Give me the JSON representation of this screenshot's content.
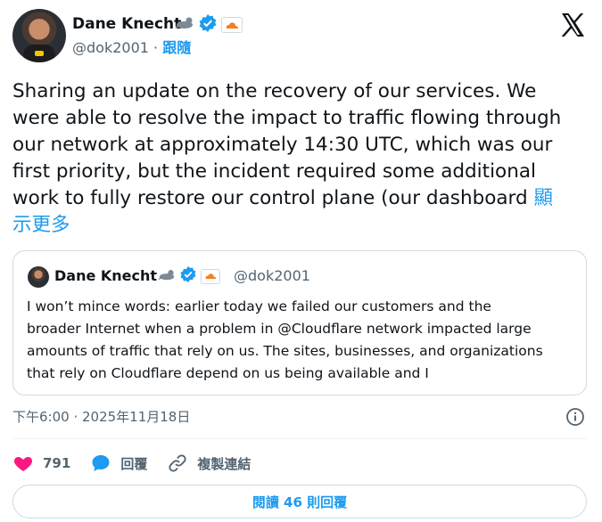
{
  "author": {
    "name": "Dane Knecht",
    "handle": "@dok2001",
    "separator": " · ",
    "follow_label": "跟隨"
  },
  "tweet": {
    "lines": [
      "Sharing an update on the recovery of our services. We",
      "were able to resolve the impact to traffic flowing through",
      "our network at approximately 14:30 UTC, which was our",
      "first priority, but the incident required some additional",
      "work to fully restore our control plane (our dashboard "
    ],
    "show_more_part1": "顯",
    "show_more_part2": "示更多"
  },
  "quote": {
    "name": "Dane Knecht",
    "handle": "@dok2001",
    "lines": [
      "I won’t mince words: earlier today we failed our customers and the",
      "broader Internet when a problem in @Cloudflare  network impacted large",
      "amounts of traffic that rely on us. The sites, businesses, and organizations",
      "that rely on Cloudflare depend on us being available and I"
    ]
  },
  "timestamp": "下午6:00 · 2025年11月18日",
  "actions": {
    "likes_count": "791",
    "reply_label": "回覆",
    "copy_link_label": "複製連結"
  },
  "read_replies_label": "閱讀 46 則回覆",
  "colors": {
    "accent": "#1d9bf0",
    "like": "#f91880",
    "text": "#0f1419",
    "muted": "#536471",
    "border": "#cfd9de"
  },
  "icons": [
    "x-logo-icon",
    "verified-badge-icon",
    "seal-emoji-icon",
    "cloudflare-logo-icon",
    "info-icon",
    "heart-icon",
    "reply-bubble-icon",
    "link-icon"
  ]
}
